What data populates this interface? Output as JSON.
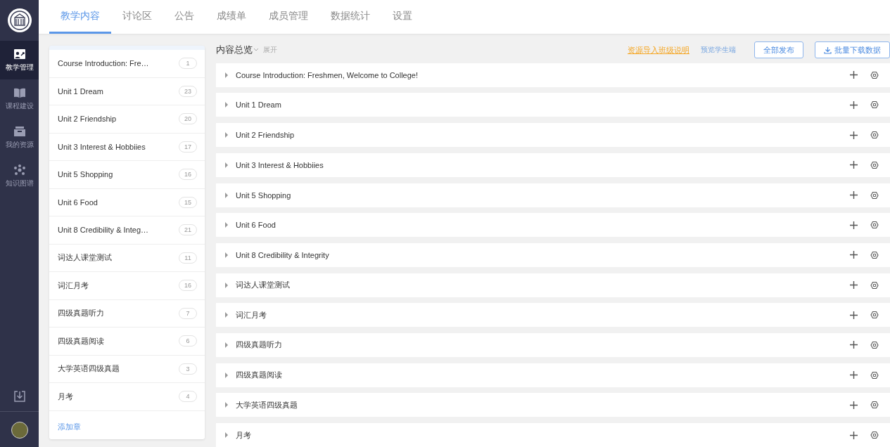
{
  "nav": [
    {
      "label": "教学管理",
      "kind": "teaching",
      "selected": true
    },
    {
      "label": "课程建设",
      "kind": "book",
      "selected": false
    },
    {
      "label": "我的资源",
      "kind": "box",
      "selected": false
    },
    {
      "label": "知识图谱",
      "kind": "graph",
      "selected": false
    }
  ],
  "tabs": [
    {
      "label": "教学内容",
      "selected": true
    },
    {
      "label": "讨论区",
      "selected": false
    },
    {
      "label": "公告",
      "selected": false
    },
    {
      "label": "成绩单",
      "selected": false
    },
    {
      "label": "成员管理",
      "selected": false
    },
    {
      "label": "数据统计",
      "selected": false
    },
    {
      "label": "设置",
      "selected": false
    }
  ],
  "chapters": [
    {
      "title": "Course Introduction: Fre…",
      "count": "1"
    },
    {
      "title": "Unit 1 Dream",
      "count": "23"
    },
    {
      "title": "Unit 2 Friendship",
      "count": "20"
    },
    {
      "title": "Unit 3 Interest & Hobbiies",
      "count": "17"
    },
    {
      "title": "Unit 5 Shopping",
      "count": "16"
    },
    {
      "title": "Unit 6 Food",
      "count": "15"
    },
    {
      "title": "Unit 8 Credibility & Integ…",
      "count": "21"
    },
    {
      "title": "词达人课堂测试",
      "count": "11"
    },
    {
      "title": "词汇月考",
      "count": "16"
    },
    {
      "title": "四级真题听力",
      "count": "7"
    },
    {
      "title": "四级真题阅读",
      "count": "6"
    },
    {
      "title": "大学英语四级真题",
      "count": "3"
    },
    {
      "title": "月考",
      "count": "4"
    }
  ],
  "add_chapter": "添加章",
  "overview": {
    "title": "内容总览",
    "expand": "展开",
    "import_link": "资源导入班级说明",
    "preview_link": "预览学生端",
    "publish_button": "全部发布",
    "download_button": "批量下载数据"
  },
  "sections": [
    "Course Introduction: Freshmen, Welcome to College!",
    "Unit 1 Dream",
    "Unit 2 Friendship",
    "Unit 3 Interest & Hobbiies",
    "Unit 5 Shopping",
    "Unit 6 Food",
    "Unit 8 Credibility & Integrity",
    "词达人课堂测试",
    "词汇月考",
    "四级真题听力",
    "四级真题阅读",
    "大学英语四级真题",
    "月考"
  ]
}
